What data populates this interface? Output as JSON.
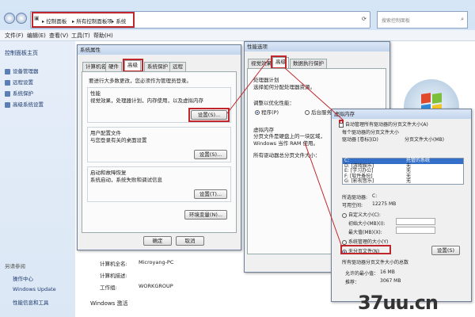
{
  "explorer": {
    "breadcrumb": [
      "控制面板",
      "所有控制面板项",
      "系统"
    ],
    "search_placeholder": "搜索控制面板",
    "menu": [
      "文件(F)",
      "编辑(E)",
      "查看(V)",
      "工具(T)",
      "帮助(H)"
    ],
    "left_title": "控制面板主页",
    "left_items": [
      "设备管理器",
      "远程设置",
      "系统保护",
      "高级系统设置"
    ],
    "see_also": "另请参阅",
    "see_also_items": [
      "操作中心",
      "Windows Update",
      "性能信息和工具"
    ],
    "info_rows": [
      {
        "label": "计算机全名:",
        "value": "Microyang-PC"
      },
      {
        "label": "计算机描述:",
        "value": ""
      },
      {
        "label": "工作组:",
        "value": "WORKGROUP"
      }
    ],
    "activation": "Windows 激活"
  },
  "sys_props": {
    "title": "系统属性",
    "tabs": [
      "计算机名",
      "硬件",
      "高级",
      "系统保护",
      "远程"
    ],
    "note": "要进行大多数更改，您必须作为管理员登录。",
    "perf_title": "性能",
    "perf_desc": "视觉效果，处理器计划，内存使用，以及虚拟内存",
    "profile_title": "用户配置文件",
    "profile_desc": "与您登录有关的桌面设置",
    "startup_title": "启动和故障恢复",
    "startup_desc": "系统启动，系统失败和调试信息",
    "settings_label": "设置(S)...",
    "settings_t_label": "设置(T)...",
    "env_label": "环境变量(N)...",
    "ok": "确定",
    "cancel": "取消"
  },
  "perf_opts": {
    "title": "性能选项",
    "tabs": [
      "视觉效果",
      "高级",
      "数据执行保护"
    ],
    "sched_title": "处理器计划",
    "sched_desc": "选择如何分配处理器资源。",
    "adjust_label": "调整以优化性能：",
    "opt_programs": "程序(P)",
    "opt_services": "后台服务(S)",
    "vm_title": "虚拟内存",
    "vm_desc": "分页文件是硬盘上的一块区域，Windows 当作 RAM 使用。",
    "vm_total": "所有驱动器总分页文件大小："
  },
  "vmem": {
    "title": "虚拟内存",
    "auto_manage": "自动管理所有驱动器的分页文件大小(A)",
    "per_drive": "每个驱动器的分页文件大小",
    "col_drive": "驱动器 [卷标](D)",
    "col_size": "分页文件大小(MB)",
    "drives": [
      {
        "drive": "C:",
        "size": "托管的系统"
      },
      {
        "drive": "D:",
        "label": "[游戏娱乐]",
        "size": "无"
      },
      {
        "drive": "E:",
        "label": "[学习办公]",
        "size": "无"
      },
      {
        "drive": "F:",
        "label": "[软件备份]",
        "size": "无"
      },
      {
        "drive": "G:",
        "label": "[影视音乐]",
        "size": "无"
      }
    ],
    "selected_label": "所选驱动器:",
    "selected_value": "C:",
    "free_label": "可用空间:",
    "free_value": "12275 MB",
    "custom": "自定义大小(C):",
    "initial": "初始大小(MB)(I):",
    "maximum": "最大值(MB)(X):",
    "system_managed": "系统管理的大小(Y)",
    "no_paging": "无分页文件(N)",
    "set_btn": "设置(S)",
    "total_title": "所有驱动器分页文件大小的总数",
    "min_label": "允许的最小值：",
    "min_value": "16 MB",
    "rec_label": "推荐：",
    "rec_value": "3067 MB"
  },
  "watermark": "37uu.cn"
}
